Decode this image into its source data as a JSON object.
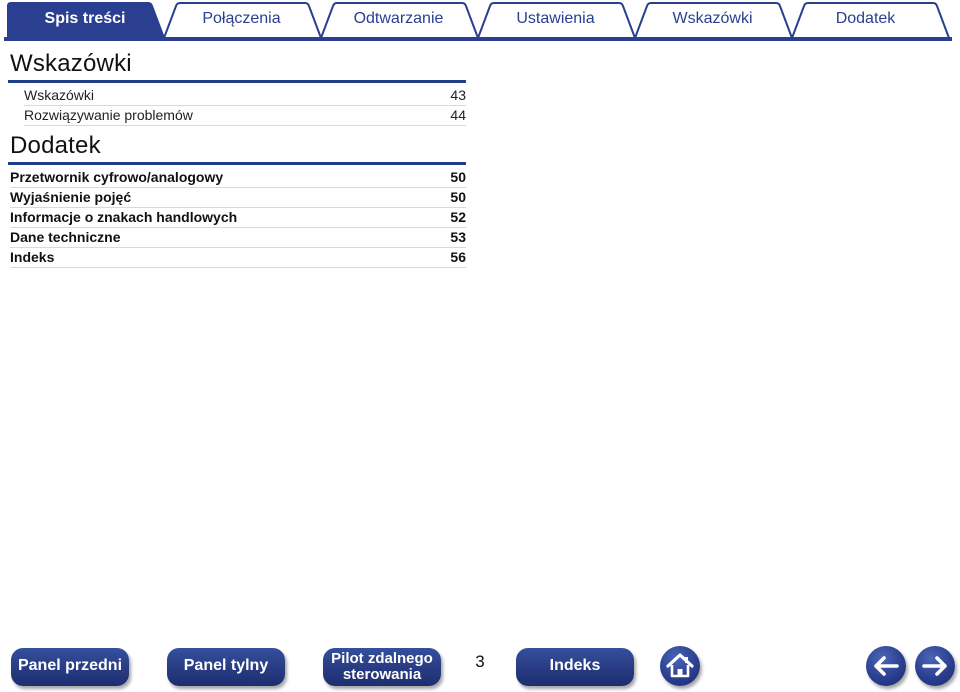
{
  "tabs": [
    {
      "label": "Spis treści",
      "active": true
    },
    {
      "label": "Połączenia",
      "active": false
    },
    {
      "label": "Odtwarzanie",
      "active": false
    },
    {
      "label": "Ustawienia",
      "active": false
    },
    {
      "label": "Wskazówki",
      "active": false
    },
    {
      "label": "Dodatek",
      "active": false
    }
  ],
  "sections": [
    {
      "title": "Wskazówki",
      "entries": [
        {
          "text": "Wskazówki",
          "page": "43"
        },
        {
          "text": "Rozwiązywanie problemów",
          "page": "44"
        }
      ]
    },
    {
      "title": "Dodatek",
      "entries": [
        {
          "text": "Przetwornik cyfrowo/analogowy",
          "page": "50"
        },
        {
          "text": "Wyjaśnienie pojęć",
          "page": "50"
        },
        {
          "text": "Informacje o znakach handlowych",
          "page": "52"
        },
        {
          "text": "Dane techniczne",
          "page": "53"
        },
        {
          "text": "Indeks",
          "page": "56"
        }
      ]
    }
  ],
  "footer": {
    "buttons": [
      {
        "label": "Panel przedni"
      },
      {
        "label": "Panel tylny"
      },
      {
        "label_line1": "Pilot zdalnego",
        "label_line2": "sterowania"
      },
      {
        "label": "Indeks"
      }
    ],
    "page_number": "3",
    "icons": {
      "home": "home-icon",
      "back": "arrow-left-icon",
      "forward": "arrow-right-icon"
    },
    "colors": {
      "accent": "#2a3f8f",
      "tab_border": "#2a3f8f",
      "active_tab": "#2a3f8f"
    }
  }
}
